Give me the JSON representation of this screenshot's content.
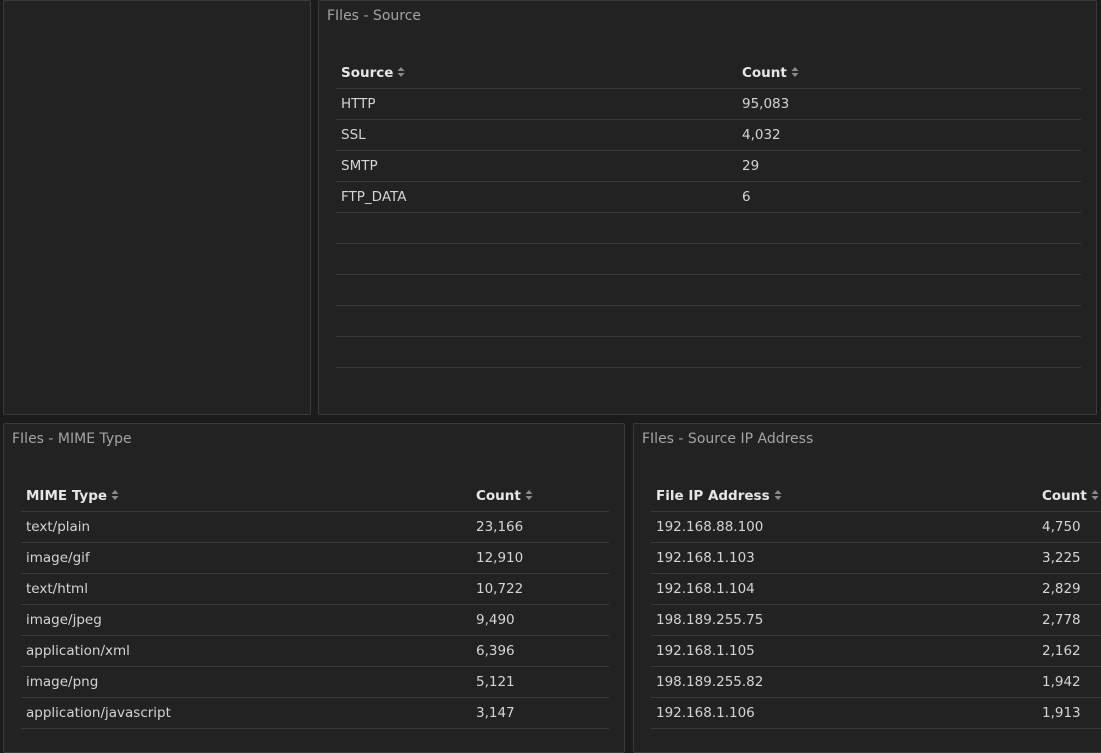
{
  "panels": {
    "source": {
      "title": "FIles - Source",
      "columns": [
        "Source",
        "Count"
      ],
      "rows": [
        [
          "HTTP",
          "95,083"
        ],
        [
          "SSL",
          "4,032"
        ],
        [
          "SMTP",
          "29"
        ],
        [
          "FTP_DATA",
          "6"
        ]
      ],
      "empty_rows": 5
    },
    "mime": {
      "title": "FIles - MIME Type",
      "columns": [
        "MIME Type",
        "Count"
      ],
      "rows": [
        [
          "text/plain",
          "23,166"
        ],
        [
          "image/gif",
          "12,910"
        ],
        [
          "text/html",
          "10,722"
        ],
        [
          "image/jpeg",
          "9,490"
        ],
        [
          "application/xml",
          "6,396"
        ],
        [
          "image/png",
          "5,121"
        ],
        [
          "application/javascript",
          "3,147"
        ]
      ]
    },
    "ip": {
      "title": "FIles - Source IP Address",
      "columns": [
        "File IP Address",
        "Count"
      ],
      "rows": [
        [
          "192.168.88.100",
          "4,750"
        ],
        [
          "192.168.1.103",
          "3,225"
        ],
        [
          "192.168.1.104",
          "2,829"
        ],
        [
          "198.189.255.75",
          "2,778"
        ],
        [
          "192.168.1.105",
          "2,162"
        ],
        [
          "198.189.255.82",
          "1,942"
        ],
        [
          "192.168.1.106",
          "1,913"
        ]
      ]
    }
  },
  "icons": {
    "sort": "sort-icon"
  },
  "colors": {
    "background": "#1b1b1b",
    "panel": "#222222",
    "border": "#3a3a3a",
    "title": "#a4a4a4",
    "text": "#d4d4d4"
  }
}
